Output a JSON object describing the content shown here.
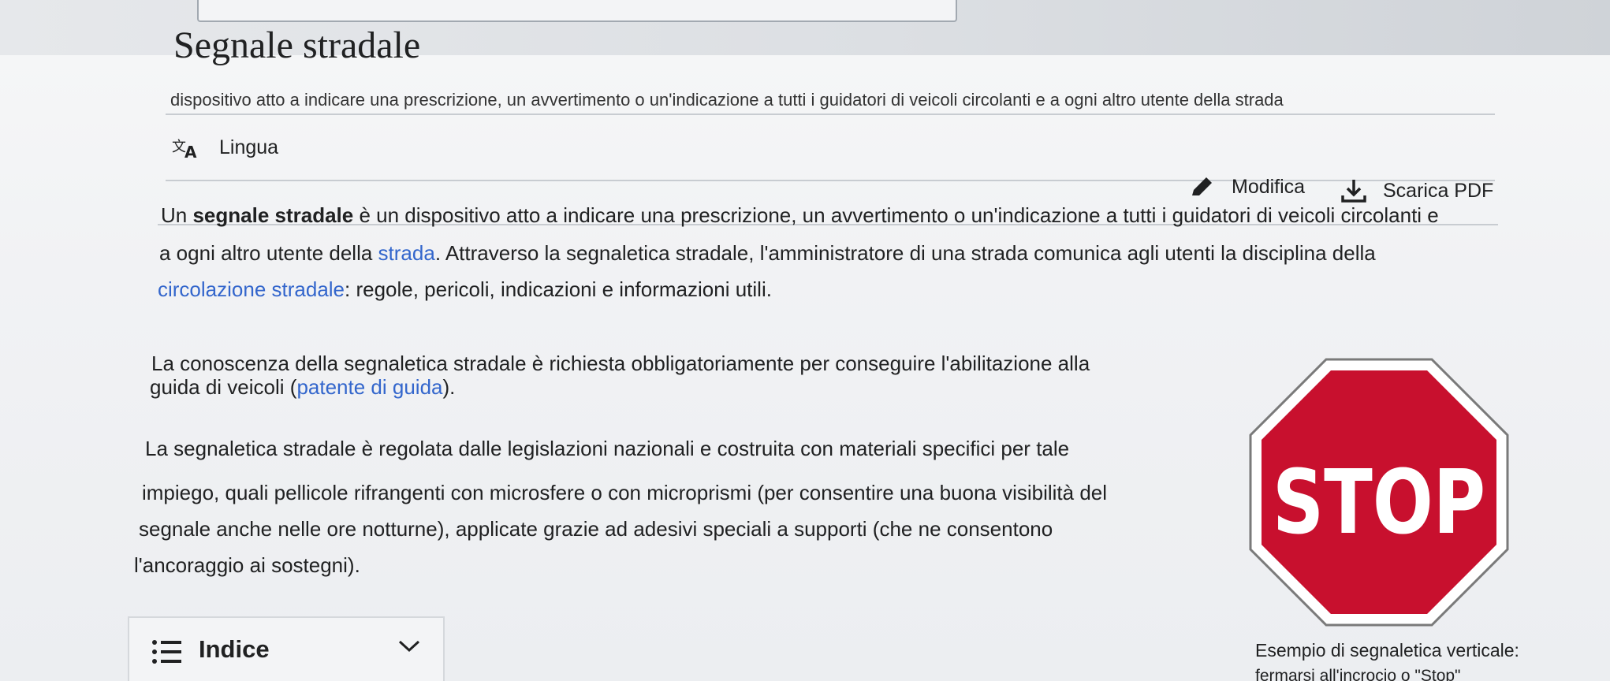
{
  "header": {
    "title": "Segnale stradale",
    "subtitle": "dispositivo atto a indicare una prescrizione, un avvertimento o un'indicazione a tutti i guidatori di veicoli circolanti e a ogni altro utente della strada"
  },
  "toolbar": {
    "language_label": "Lingua",
    "edit_label": "Modifica",
    "download_label": "Scarica PDF"
  },
  "article": {
    "p1": {
      "l1_start": "Un ",
      "l1_bold": "segnale stradale",
      "l1_end": " è un dispositivo atto a indicare una prescrizione, un avvertimento o un'indicazione a tutti i guidatori di veicoli circolanti e",
      "l2_start": "a ogni altro utente della ",
      "l2_link": "strada",
      "l2_end": ". Attraverso la segnaletica stradale, l'amministratore di una strada comunica agli utenti la disciplina della",
      "l3_link": "circolazione stradale",
      "l3_end": ": regole, pericoli, indicazioni e informazioni utili."
    },
    "p2": {
      "l1": "La conoscenza della segnaletica stradale è richiesta obbligatoriamente per conseguire l'abilitazione alla",
      "l2_start": "guida di veicoli (",
      "l2_link": "patente di guida",
      "l2_end": ")."
    },
    "p3": {
      "l1": "La segnaletica stradale è regolata dalle legislazioni nazionali e costruita con materiali specifici per tale",
      "l2": "impiego, quali pellicole rifrangenti con microsfere o con microprismi (per consentire una buona visibilità del",
      "l3": "segnale anche nelle ore notturne), applicate grazie ad adesivi speciali a supporti (che ne consentono",
      "l4": "l'ancoraggio ai sostegni)."
    }
  },
  "toc": {
    "label": "Indice"
  },
  "figure": {
    "sign_text": "STOP",
    "caption_l1": "Esempio di segnaletica verticale:",
    "caption_l2": "fermarsi all'incrocio o \"Stop\""
  },
  "colors": {
    "link": "#3366cc",
    "sign_red": "#c8102e",
    "text": "#202122"
  },
  "icons": [
    "translate-icon",
    "pencil-icon",
    "download-icon",
    "list-icon",
    "chevron-down-icon"
  ]
}
